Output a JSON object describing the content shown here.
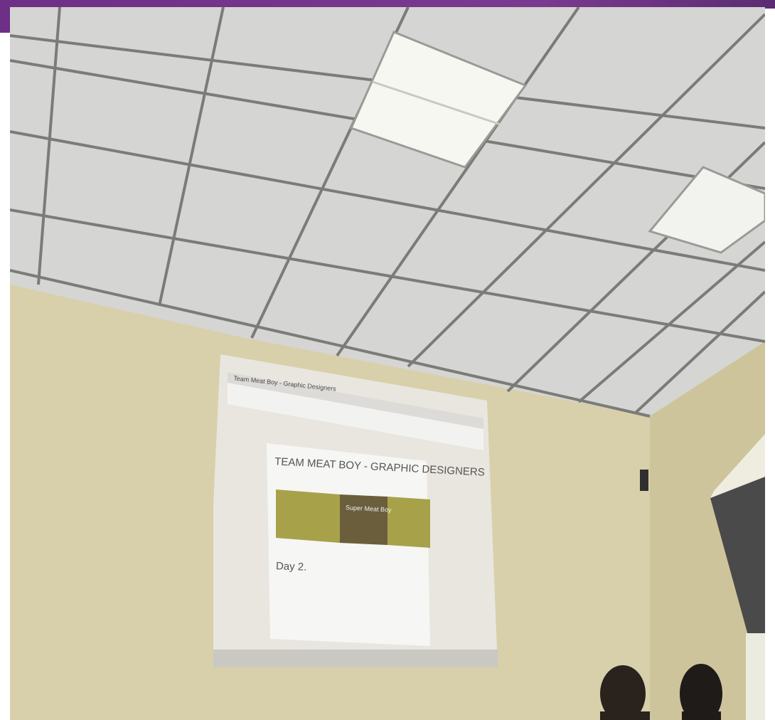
{
  "projection": {
    "doc_tab_title": "Team Meat Boy - Graphic Designers",
    "doc_heading": "TEAM MEAT BOY - GRAPHIC DESIGNERS",
    "banner_right_title": "Super Meat Boy",
    "section_heading": "Day 2."
  },
  "colors": {
    "accent": "#6e2f86",
    "ceiling": "#d7d7d7",
    "wall": "#d8d0aa",
    "banner_olive": "#a7a24a",
    "banner_dark": "#6b5e3c"
  }
}
